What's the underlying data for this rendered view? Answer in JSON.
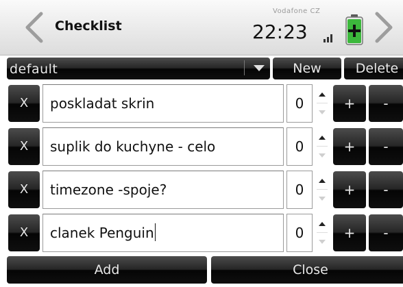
{
  "header": {
    "title": "Checklist",
    "carrier": "Vodafone CZ",
    "time": "22:23",
    "icons": {
      "back": "chevron-left-icon",
      "forward": "chevron-right-icon",
      "signal": "signal-icon",
      "battery": "battery-charging-icon"
    }
  },
  "list_selector": {
    "selected": "default",
    "new_label": "New",
    "delete_label": "Delete"
  },
  "items": [
    {
      "x_label": "X",
      "text": "poskladat skrin",
      "count": "0",
      "plus_label": "+",
      "minus_label": "-"
    },
    {
      "x_label": "X",
      "text": "suplik do kuchyne - celo",
      "count": "0",
      "plus_label": "+",
      "minus_label": "-"
    },
    {
      "x_label": "X",
      "text": "timezone -spoje?",
      "count": "0",
      "plus_label": "+",
      "minus_label": "-"
    },
    {
      "x_label": "X",
      "text": "clanek Penguin",
      "count": "0",
      "plus_label": "+",
      "minus_label": "-"
    }
  ],
  "footer": {
    "add_label": "Add",
    "close_label": "Close"
  },
  "colors": {
    "button_dark": "#1a1a1a",
    "battery_green": "#3cb83c"
  }
}
